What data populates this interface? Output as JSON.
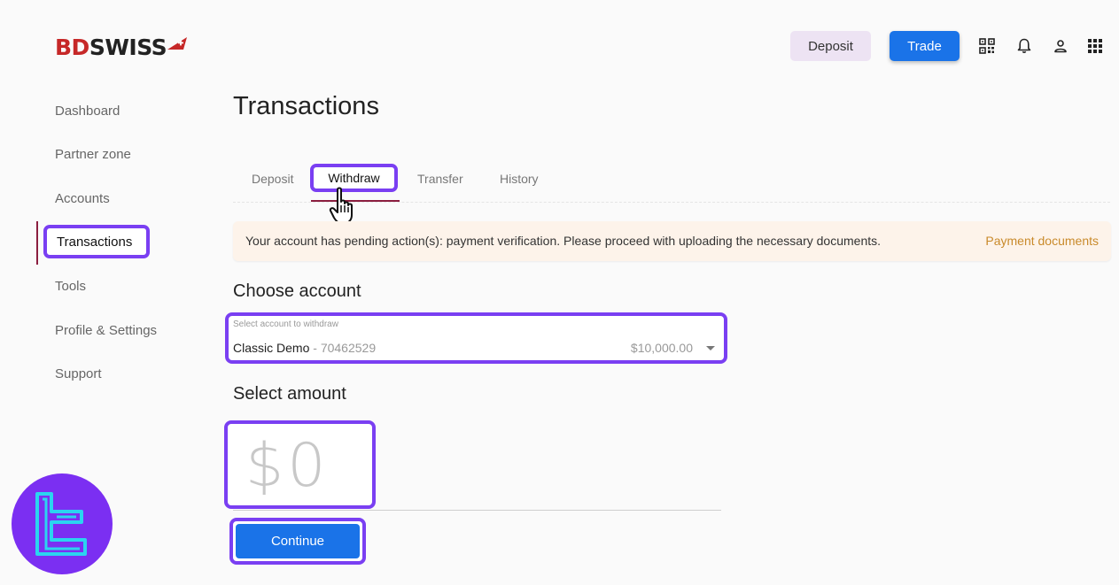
{
  "header": {
    "logo": {
      "part1": "BD",
      "part2": "SWISS"
    },
    "deposit_label": "Deposit",
    "trade_label": "Trade",
    "icons": [
      "qr-code-icon",
      "bell-icon",
      "user-icon",
      "apps-grid-icon"
    ]
  },
  "sidebar": {
    "items": [
      {
        "label": "Dashboard"
      },
      {
        "label": "Partner zone"
      },
      {
        "label": "Accounts"
      },
      {
        "label": "Transactions",
        "active": true
      },
      {
        "label": "Tools"
      },
      {
        "label": "Profile & Settings"
      },
      {
        "label": "Support"
      }
    ]
  },
  "main": {
    "title": "Transactions",
    "tabs": [
      {
        "label": "Deposit"
      },
      {
        "label": "Withdraw",
        "active": true
      },
      {
        "label": "Transfer"
      },
      {
        "label": "History"
      }
    ],
    "notice": {
      "text": "Your account has pending action(s): payment verification. Please proceed with uploading the necessary documents.",
      "link": "Payment documents"
    },
    "choose_account": {
      "title": "Choose account",
      "field_label": "Select account to withdraw",
      "account_name": "Classic Demo",
      "account_sep": " - ",
      "account_number": "70462529",
      "balance": "$10,000.00"
    },
    "select_amount": {
      "title": "Select amount",
      "value": "$0"
    },
    "continue_label": "Continue"
  },
  "colors": {
    "highlight": "#7a3ff2",
    "primary": "#1a73e8",
    "brand_red": "#c62828",
    "active_bar": "#8b1e3f",
    "notice_bg": "#fdf3ea",
    "notice_link": "#c98a2b"
  }
}
